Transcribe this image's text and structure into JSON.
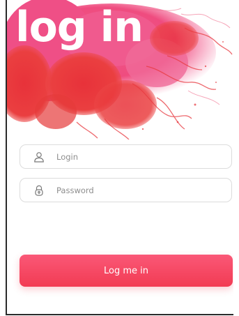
{
  "hero": {
    "title": "log in"
  },
  "form": {
    "login_placeholder": "Login",
    "password_placeholder": "Password",
    "submit_label": "Log me in"
  },
  "icons": {
    "login": "user-icon",
    "password": "lock-icon"
  },
  "colors": {
    "accent": "#f23b53",
    "accent_light": "#fa5877",
    "smoke_pink": "#f0588a",
    "smoke_red": "#e8323a"
  }
}
